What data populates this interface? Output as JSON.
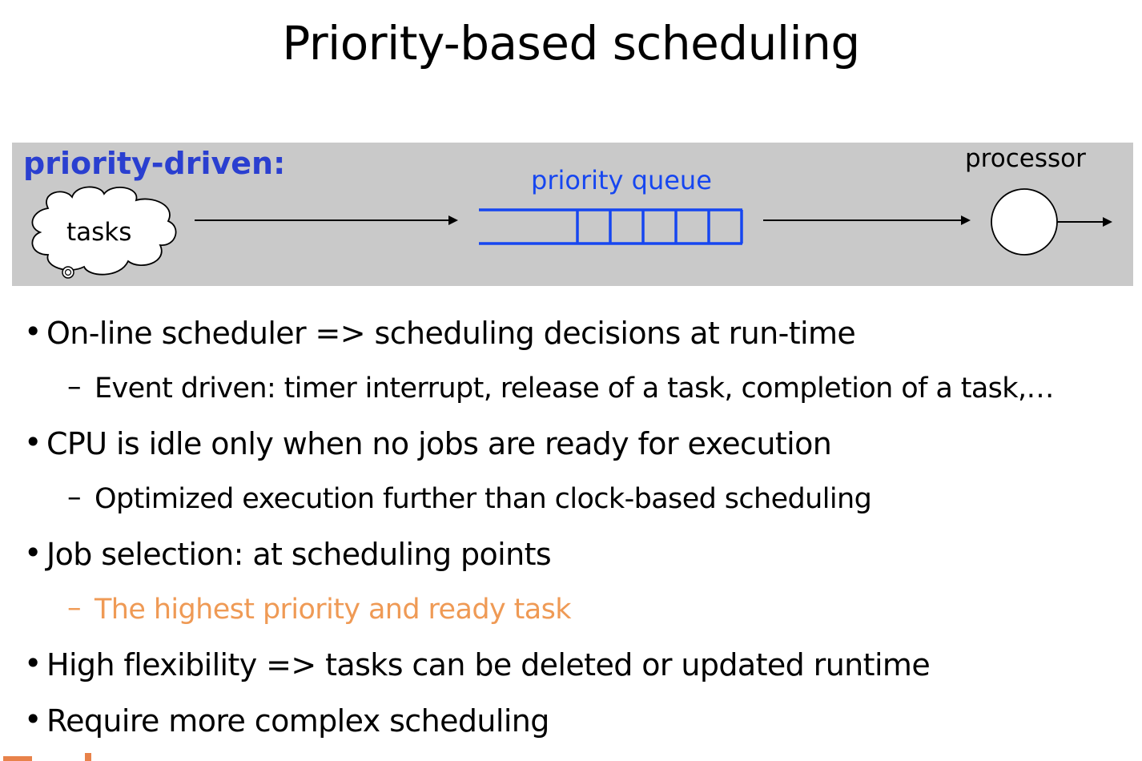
{
  "title": "Priority-based scheduling",
  "diagram": {
    "heading": "priority-driven:",
    "tasks_label": "tasks",
    "queue_label": "priority queue",
    "processor_label": "processor",
    "colors": {
      "blue": "#2a3fd0",
      "queue_blue": "#1646f0",
      "background": "#c9c9c9"
    }
  },
  "bullets": [
    {
      "level": 1,
      "text": "On-line scheduler => scheduling decisions at run-time"
    },
    {
      "level": 2,
      "text": "Event driven: timer interrupt, release of a task, completion of a task,…"
    },
    {
      "level": 1,
      "text": "CPU is idle only when no jobs are ready for execution"
    },
    {
      "level": 2,
      "text": "Optimized execution further than clock-based scheduling"
    },
    {
      "level": 1,
      "text": "Job selection: at scheduling points"
    },
    {
      "level": 2,
      "text": "The highest priority and ready task",
      "highlight": true
    },
    {
      "level": 1,
      "text": "High flexibility => tasks can be deleted or updated runtime"
    },
    {
      "level": 1,
      "text": "Require more complex scheduling"
    }
  ],
  "bullet_symbols": {
    "level1": "•",
    "level2": "–"
  }
}
